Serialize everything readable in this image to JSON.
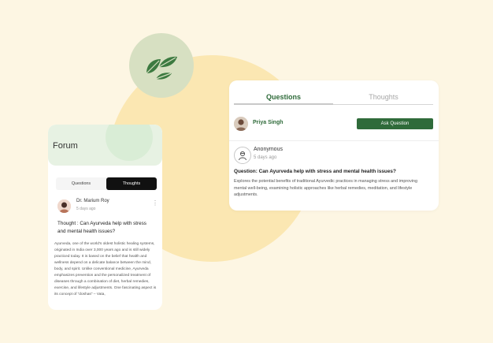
{
  "colors": {
    "brand_green": "#2f6b3a",
    "background": "#fdf6e3"
  },
  "right_card": {
    "tabs": [
      {
        "label": "Questions",
        "active": true
      },
      {
        "label": "Thoughts",
        "active": false
      }
    ],
    "current_user": "Priya Singh",
    "ask_button": "Ask Question",
    "post": {
      "author": "Anonymous",
      "time": "5 days ago",
      "question": "Question: Can Ayurveda help with stress and mental health issues?",
      "body": "Explores the potential benefits of traditional Ayurvedic practices in managing stress and improving mental well-being, examining holistic approaches like herbal remedies, meditation, and lifestyle adjustments."
    }
  },
  "left_panel": {
    "title": "Forum",
    "tabs": [
      {
        "label": "Questions",
        "active": false
      },
      {
        "label": "Thoughts",
        "active": true
      }
    ],
    "post": {
      "author": "Dr. Marium Roy",
      "time": "5 days ago",
      "thought": "Thought : Can Ayurveda help with stress and mental health issues?",
      "body": "Ayurveda, one of the world's oldest holistic healing systems, originated in India over 3,000 years ago and is still widely practiced today. It is based on the belief that health and wellness depend on a delicate balance between the mind, body, and spirit. Unlike conventional medicine, Ayurveda emphasizes prevention and the personalized treatment of diseases through a combination of diet, herbal remedies, exercise, and lifestyle adjustments. One fascinating aspect is its concept of \"doshas\" – Vata,"
    }
  }
}
